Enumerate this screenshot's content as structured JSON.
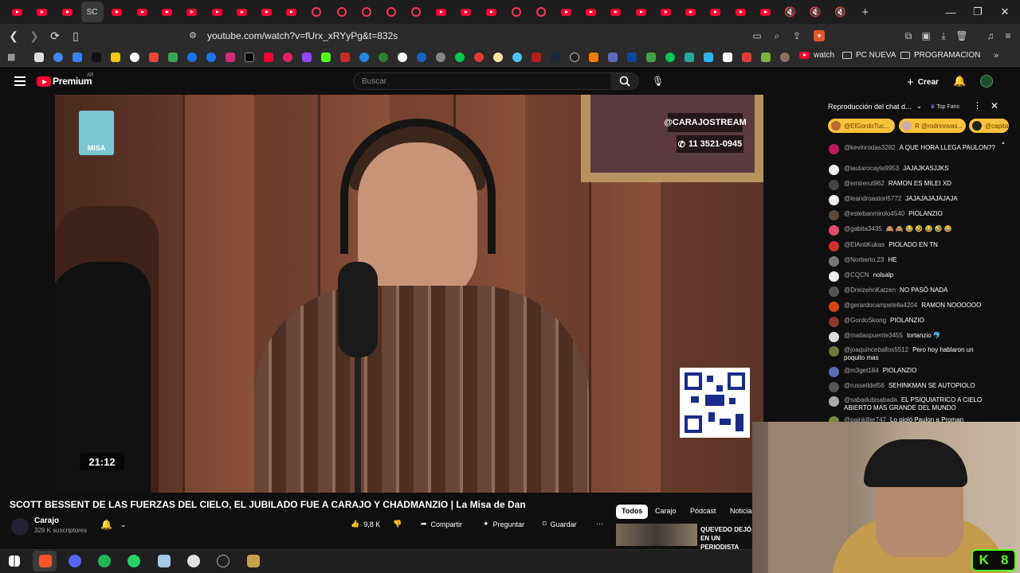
{
  "browser": {
    "active_tab_label": "SC",
    "url": "youtube.com/watch?v=fUrx_xRYyPg&t=832s",
    "bookmark_folders": [
      "watch",
      "PC NUEVA",
      "PROGRAMACION"
    ]
  },
  "youtube": {
    "logo_text": "Premium",
    "region": "AR",
    "search_placeholder": "Buscar",
    "create_label": "Crear"
  },
  "video": {
    "time_overlay": "21:12",
    "handle_overlay": "@CARAJOSTREAM",
    "phone_overlay": "11 3521-0945",
    "logo_text": "MISA",
    "title": "SCOTT BESSENT DE LAS FUERZAS DEL CIELO, EL JUBILADO FUE A CARAJO Y CHADMANZIO | La Misa de Dan",
    "channel_name": "Carajo",
    "subscribers": "329 K suscriptores",
    "likes": "9,8 K",
    "share_label": "Compartir",
    "ask_label": "Preguntar",
    "save_label": "Guardar",
    "more_label": "···"
  },
  "filters": [
    "Todos",
    "Carajo",
    "Pódcast",
    "Noticias"
  ],
  "recommendation": {
    "title": "QUEVEDO DEJÓ EN UN PERIODISTA TRAS..."
  },
  "chat": {
    "header": "Reproducción del chat d...",
    "top_fans_label": "Top Fans",
    "fans": [
      "@ElGordoTuc...",
      "R @rodrinovas...",
      "@capita"
    ],
    "messages": [
      {
        "user": "@kevinrodas3282",
        "text": "A QUE HORA LLEGA PAULON??",
        "color": "#c2185b"
      },
      {
        "user": "@lautarocayla9953",
        "text": "JAJAJKASJJKS",
        "color": "#eeeeee"
      },
      {
        "user": "@emirerut962",
        "text": "RAMON ES MILEI XD",
        "color": "#444444"
      },
      {
        "user": "@leandroastori5772",
        "text": "JAJAJAJAJAJAJA",
        "color": "#eeeeee"
      },
      {
        "user": "@estebanmirolo4540",
        "text": "PIOLANZIO",
        "color": "#5a4a3a"
      },
      {
        "user": "@gabita3435",
        "text": "🙈 🙈 😂 🤣 😂 🤣 😂",
        "color": "#e64a6a"
      },
      {
        "user": "@ElAntiKukas",
        "text": "PIOLADO EN TN",
        "color": "#d32f2f"
      },
      {
        "user": "@Norberto.23",
        "text": "HE",
        "color": "#777777"
      },
      {
        "user": "@CQCN",
        "text": "nolsalp",
        "color": "#eeeeee"
      },
      {
        "user": "@DreizehnKatzen",
        "text": "NO PASÓ NADA",
        "color": "#555555"
      },
      {
        "user": "@gerardocampetella4204",
        "text": "RAMON NOOOOOO",
        "color": "#d84315"
      },
      {
        "user": "@GordoSkong",
        "text": "PIOLANZIO",
        "color": "#8b3a2a"
      },
      {
        "user": "@matiaspuente3455",
        "text": "tortanzio 🐬",
        "color": "#dddddd"
      },
      {
        "user": "@joaquinceballos5512",
        "text": "Pero hoy hablaron un poquito mas",
        "color": "#6a7a3a"
      },
      {
        "user": "@m3get184",
        "text": "PIOLANZIO",
        "color": "#5a6ab0"
      },
      {
        "user": "@russelldel56",
        "text": "SEHINKMAN SE AUTOPIOLO",
        "color": "#555555"
      },
      {
        "user": "@sabadubisabada",
        "text": "EL PSIQUIATRICO A CIELO ABIERTO MAS GRANDE DEL MUNDO",
        "color": "#aaaaaa"
      },
      {
        "user": "@painkiller747",
        "text": "Lo pioló Paulon a Proman",
        "color": "#7a8a3a"
      }
    ]
  },
  "kick_badge": {
    "letter": "K",
    "digit": "8"
  },
  "colors": {
    "accent_red": "#ff0033",
    "kick_green": "#53fc18",
    "fan_gold": "#f8c23a"
  }
}
